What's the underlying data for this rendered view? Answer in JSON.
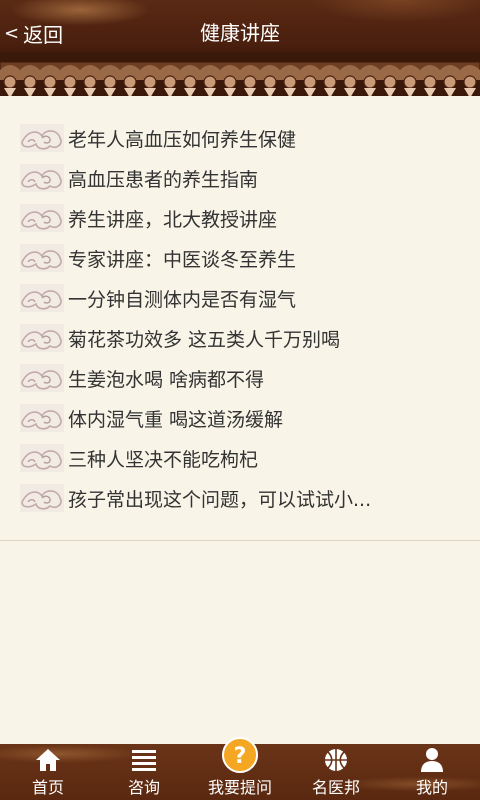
{
  "header": {
    "back_label": "返回",
    "title": "健康讲座"
  },
  "list": {
    "items": [
      {
        "title": "老年人高血压如何养生保健"
      },
      {
        "title": "高血压患者的养生指南"
      },
      {
        "title": "养生讲座，北大教授讲座"
      },
      {
        "title": "专家讲座：中医谈冬至养生"
      },
      {
        "title": "一分钟自测体内是否有湿气"
      },
      {
        "title": "菊花茶功效多 这五类人千万别喝"
      },
      {
        "title": "生姜泡水喝 啥病都不得"
      },
      {
        "title": "体内湿气重 喝这道汤缓解"
      },
      {
        "title": "三种人坚决不能吃枸杞"
      },
      {
        "title": "孩子常出现这个问题，可以试试小..."
      }
    ]
  },
  "tabbar": {
    "tabs": [
      {
        "label": "首页",
        "icon": "home-icon"
      },
      {
        "label": "咨询",
        "icon": "list-icon"
      },
      {
        "label": "我要提问",
        "icon": "question-icon"
      },
      {
        "label": "名医邦",
        "icon": "basketball-icon"
      },
      {
        "label": "我的",
        "icon": "user-icon"
      }
    ]
  },
  "colors": {
    "header_bg": "#4a1f0e",
    "page_bg": "#f8f4e8",
    "text": "#333333",
    "tab_accent": "#f5a623"
  }
}
